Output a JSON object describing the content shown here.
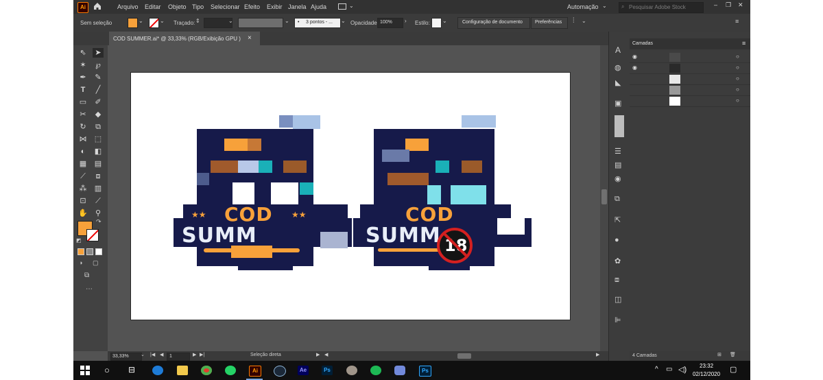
{
  "menubar": {
    "app_badge": "Ai",
    "items": [
      "Arquivo",
      "Editar",
      "Objeto",
      "Tipo",
      "Selecionar",
      "Efeito",
      "Exibir",
      "Janela",
      "Ajuda"
    ],
    "workspace": "Automação",
    "search_placeholder": "Pesquisar Adobe Stock"
  },
  "control_bar": {
    "selection_label": "Sem seleção",
    "stroke_label": "Traçado:",
    "stroke_style": "3 pontos - ...",
    "opacity_label": "Opacidade:",
    "opacity_value": "100%",
    "style_label": "Estilo:",
    "doc_setup_button": "Configuração de documento",
    "preferences_button": "Preferências"
  },
  "document_tab": {
    "title": "COD SUMMER.ai* @ 33,33% (RGB/Exibição GPU )",
    "close": "×"
  },
  "artwork": {
    "left_logo": {
      "line1": "COD",
      "line2": "SUMM"
    },
    "right_logo": {
      "line1": "COD",
      "line2": "SUMM",
      "badge": "18"
    }
  },
  "status_bar": {
    "zoom": "33,33%",
    "page": "1",
    "tool": "Seleção direta"
  },
  "layers_panel": {
    "tab": "Camadas",
    "footer": "4 Camadas"
  },
  "taskbar": {
    "time": "23:32",
    "date": "02/12/2020"
  },
  "colors": {
    "accent_fill": "#f7a13a",
    "navy": "#161a4a",
    "ui_dark": "#323232",
    "ui_mid": "#535353"
  }
}
